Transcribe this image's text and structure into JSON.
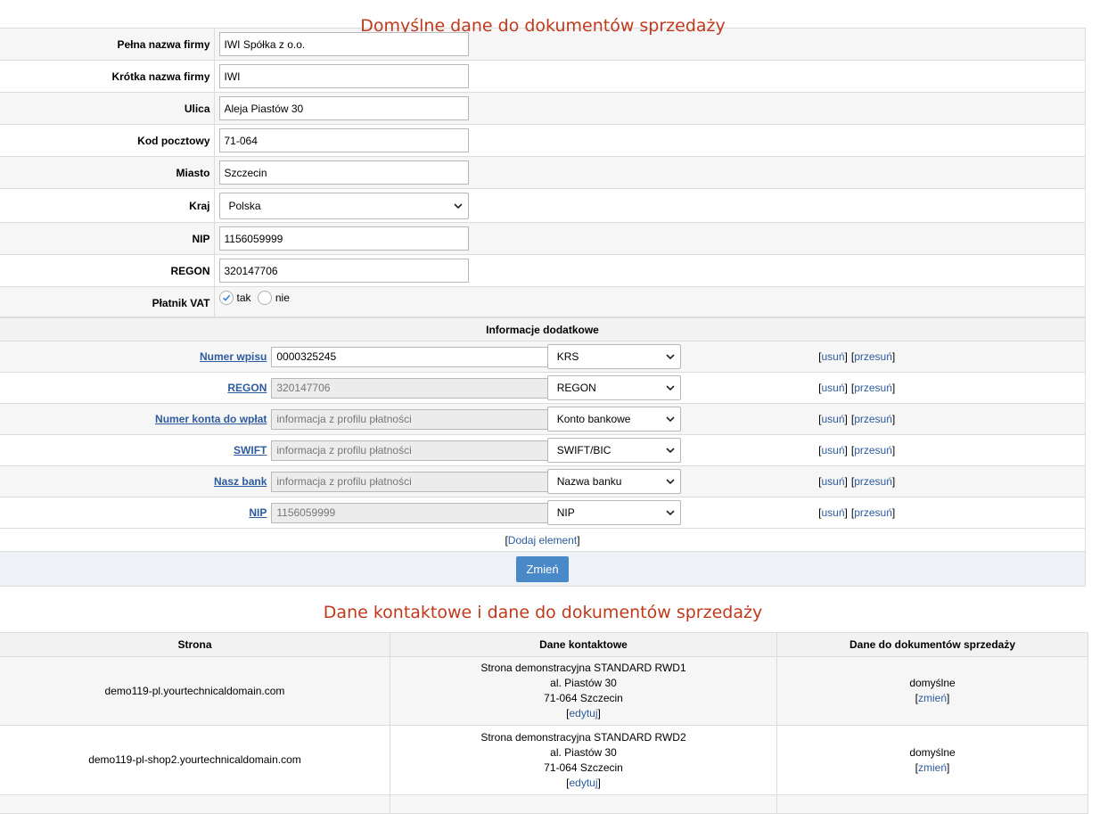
{
  "section1": {
    "title": "Domyślne dane do dokumentów sprzedaży",
    "fields": {
      "full_name": {
        "label": "Pełna nazwa firmy",
        "value": "IWI Spółka z o.o."
      },
      "short_name": {
        "label": "Krótka nazwa firmy",
        "value": "IWI"
      },
      "street": {
        "label": "Ulica",
        "value": "Aleja Piastów 30"
      },
      "postal": {
        "label": "Kod pocztowy",
        "value": "71-064"
      },
      "city": {
        "label": "Miasto",
        "value": "Szczecin"
      },
      "country": {
        "label": "Kraj",
        "value": "Polska"
      },
      "nip": {
        "label": "NIP",
        "value": "1156059999"
      },
      "regon": {
        "label": "REGON",
        "value": "320147706"
      },
      "vat": {
        "label": "Płatnik VAT",
        "yes": "tak",
        "no": "nie",
        "selected": "tak"
      }
    }
  },
  "info": {
    "heading": "Informacje dodatkowe",
    "remove_label": "usuń",
    "move_label": "przesuń",
    "rows": [
      {
        "label": "Numer wpisu",
        "value": "0000325245",
        "readonly": false,
        "type": "KRS"
      },
      {
        "label": "REGON",
        "value": "320147706",
        "readonly": true,
        "type": "REGON"
      },
      {
        "label": "Numer konta do wpłat",
        "value": "informacja z profilu płatności",
        "readonly": true,
        "type": "Konto bankowe"
      },
      {
        "label": "SWIFT",
        "value": "informacja z profilu płatności",
        "readonly": true,
        "type": "SWIFT/BIC"
      },
      {
        "label": "Nasz bank",
        "value": "informacja z profilu płatności",
        "readonly": true,
        "type": "Nazwa banku"
      },
      {
        "label": "NIP",
        "value": "1156059999",
        "readonly": true,
        "type": "NIP"
      }
    ],
    "add_label": "Dodaj element",
    "submit_label": "Zmień"
  },
  "section2": {
    "title": "Dane kontaktowe i dane do dokumentów sprzedaży",
    "headers": [
      "Strona",
      "Dane kontaktowe",
      "Dane do dokumentów sprzedaży"
    ],
    "edit_label": "edytuj",
    "change_label": "zmień",
    "rows": [
      {
        "site": "demo119-pl.yourtechnicaldomain.com",
        "contact_name": "Strona demonstracyjna STANDARD RWD1",
        "contact_street": "al. Piastów 30",
        "contact_city": "71-064 Szczecin",
        "docs": "domyślne"
      },
      {
        "site": "demo119-pl-shop2.yourtechnicaldomain.com",
        "contact_name": "Strona demonstracyjna STANDARD RWD2",
        "contact_street": "al. Piastów 30",
        "contact_city": "71-064 Szczecin",
        "docs": "domyślne"
      }
    ]
  }
}
